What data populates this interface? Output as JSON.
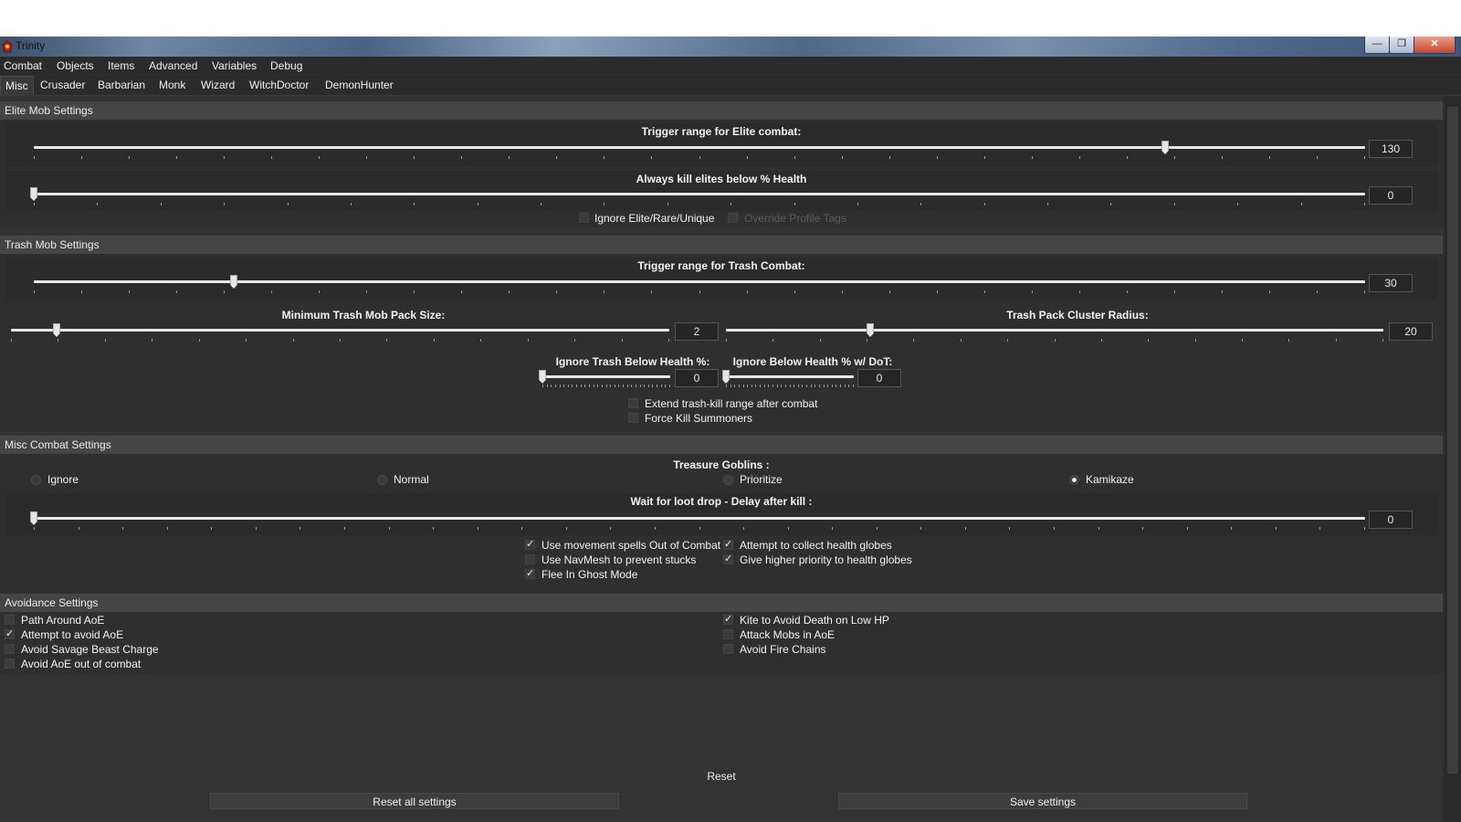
{
  "window": {
    "title": "Trinity",
    "controls": {
      "minimize": "—",
      "maximize": "❐",
      "close": "✕"
    }
  },
  "menu": [
    "Combat",
    "Objects",
    "Items",
    "Advanced",
    "Variables",
    "Debug"
  ],
  "tabs": [
    "Misc",
    "Crusader",
    "Barbarian",
    "Monk",
    "Wizard",
    "WitchDoctor",
    "DemonHunter"
  ],
  "active_tab": "Misc",
  "elite": {
    "header": "Elite Mob Settings",
    "trigger_range": {
      "label": "Trigger range for Elite combat:",
      "value": "130",
      "fraction": 0.85
    },
    "kill_below_health": {
      "label": "Always kill elites below % Health",
      "value": "0",
      "fraction": 0.0
    },
    "ignore_elite": {
      "label": "Ignore Elite/Rare/Unique",
      "checked": false
    },
    "override_profile_tags": {
      "label": "Override Profile Tags",
      "checked": false,
      "disabled": true
    }
  },
  "trash": {
    "header": "Trash Mob Settings",
    "trigger_range": {
      "label": "Trigger range for Trash Combat:",
      "value": "30",
      "fraction": 0.15
    },
    "min_pack_size": {
      "label": "Minimum Trash Mob Pack Size:",
      "value": "2",
      "fraction": 0.07
    },
    "cluster_radius": {
      "label": "Trash Pack Cluster Radius:",
      "value": "20",
      "fraction": 0.22
    },
    "ignore_below_health": {
      "label": "Ignore Trash Below Health %:",
      "value": "0",
      "fraction": 0.0
    },
    "ignore_below_health_dot": {
      "label": "Ignore Below Health % w/ DoT:",
      "value": "0",
      "fraction": 0.0
    },
    "extend_range": {
      "label": "Extend trash-kill range after combat",
      "checked": false
    },
    "force_kill_summoners": {
      "label": "Force Kill Summoners",
      "checked": false
    }
  },
  "misc_combat": {
    "header": "Misc Combat Settings",
    "goblins": {
      "label": "Treasure Goblins :",
      "options": [
        "Ignore",
        "Normal",
        "Prioritize",
        "Kamikaze"
      ],
      "selected": "Kamikaze"
    },
    "loot_delay": {
      "label": "Wait for loot drop - Delay after kill :",
      "value": "0",
      "fraction": 0.0
    },
    "movement_spells": {
      "label": "Use movement spells Out of Combat",
      "checked": true
    },
    "navmesh": {
      "label": "Use NavMesh to prevent stucks",
      "checked": false
    },
    "flee_ghost": {
      "label": "Flee In Ghost Mode",
      "checked": true
    },
    "collect_globes": {
      "label": "Attempt to collect health globes",
      "checked": true
    },
    "priority_globes": {
      "label": "Give higher priority to health globes",
      "checked": true
    }
  },
  "avoidance": {
    "header": "Avoidance Settings",
    "left": [
      {
        "label": "Path Around AoE",
        "checked": false
      },
      {
        "label": "Attempt to avoid AoE",
        "checked": true
      },
      {
        "label": "Avoid Savage Beast Charge",
        "checked": false
      },
      {
        "label": "Avoid AoE out of combat",
        "checked": false
      }
    ],
    "right": [
      {
        "label": "Kite to Avoid Death on Low HP",
        "checked": true
      },
      {
        "label": "Attack Mobs in AoE",
        "checked": false
      },
      {
        "label": "Avoid Fire Chains",
        "checked": false
      }
    ]
  },
  "buttons": {
    "reset": "Reset",
    "reset_all": "Reset all settings",
    "save": "Save settings"
  }
}
